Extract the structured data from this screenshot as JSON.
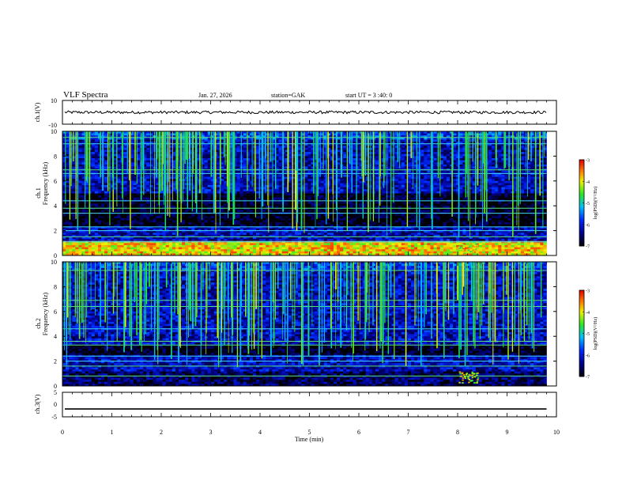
{
  "header": {
    "title": "VLF  Spectra",
    "date": "Jan. 27, 2026",
    "station": "station=GAK",
    "start_ut": "start  UT  =   3  :40: 0"
  },
  "chart_data": [
    {
      "type": "line",
      "panel": "ch1-waveform",
      "ylabel": "ch.1(V)",
      "ylim": [
        -10,
        10
      ],
      "yticks": [
        "10",
        "-10"
      ],
      "baseline": 0,
      "noise_amplitude": 1.2
    },
    {
      "type": "heatmap",
      "panel": "ch1-spectrogram",
      "ylabel_lines": [
        "ch.1",
        "Frequency  (kHz)"
      ],
      "ylim": [
        0,
        10
      ],
      "yticks": [
        "0",
        "2",
        "4",
        "6",
        "8",
        "10"
      ],
      "colorbar": {
        "label": "log(PSD)(V²/Hz)",
        "ticks": [
          "-3",
          "-4",
          "-5",
          "-6",
          "-7"
        ],
        "range": [
          -7,
          -3
        ]
      },
      "features": {
        "strong_band_khz": [
          0.0,
          1.1
        ],
        "hum_lines_khz": [
          1.1,
          1.5,
          2.0,
          2.3,
          3.4,
          3.8,
          4.4,
          6.6,
          6.9,
          9.0,
          9.5
        ],
        "dark_band_khz": [
          2.4,
          5.0
        ],
        "spherics": "broadband impulses 2–10 kHz throughout",
        "emission_khz": [
          0.2,
          1.1
        ],
        "emission_time_min": [
          8.0,
          8.4
        ]
      }
    },
    {
      "type": "heatmap",
      "panel": "ch2-spectrogram",
      "ylabel_lines": [
        "ch.2",
        "Frequency  (kHz)"
      ],
      "ylim": [
        0,
        10
      ],
      "yticks": [
        "0",
        "2",
        "4",
        "6",
        "8",
        "10"
      ],
      "colorbar": {
        "label": "log(PSD)(V²/Hz)",
        "ticks": [
          "-3",
          "-4",
          "-5",
          "-6",
          "-7"
        ],
        "range": [
          -7,
          -3
        ]
      },
      "features": {
        "hum_lines_khz": [
          0.8,
          1.6,
          2.0,
          2.4,
          3.3,
          3.6,
          4.6,
          6.4,
          6.9,
          9.3
        ],
        "dark_band_khz": [
          2.5,
          3.4
        ],
        "spherics": "broadband impulses 1–10 kHz throughout",
        "emission_khz": [
          0.3,
          1.2
        ],
        "emission_time_min": [
          8.0,
          8.4
        ]
      }
    },
    {
      "type": "line",
      "panel": "ch3-waveform",
      "ylabel": "ch.3(V)",
      "ylim": [
        -5,
        5
      ],
      "yticks": [
        "5",
        "0",
        "-5"
      ],
      "baseline": -1.8
    }
  ],
  "xaxis": {
    "label": "Time  (min)",
    "ticks": [
      "0",
      "1",
      "2",
      "3",
      "4",
      "5",
      "6",
      "7",
      "8",
      "9",
      "10"
    ],
    "range": [
      0,
      10
    ],
    "data_end_min": 9.8
  }
}
